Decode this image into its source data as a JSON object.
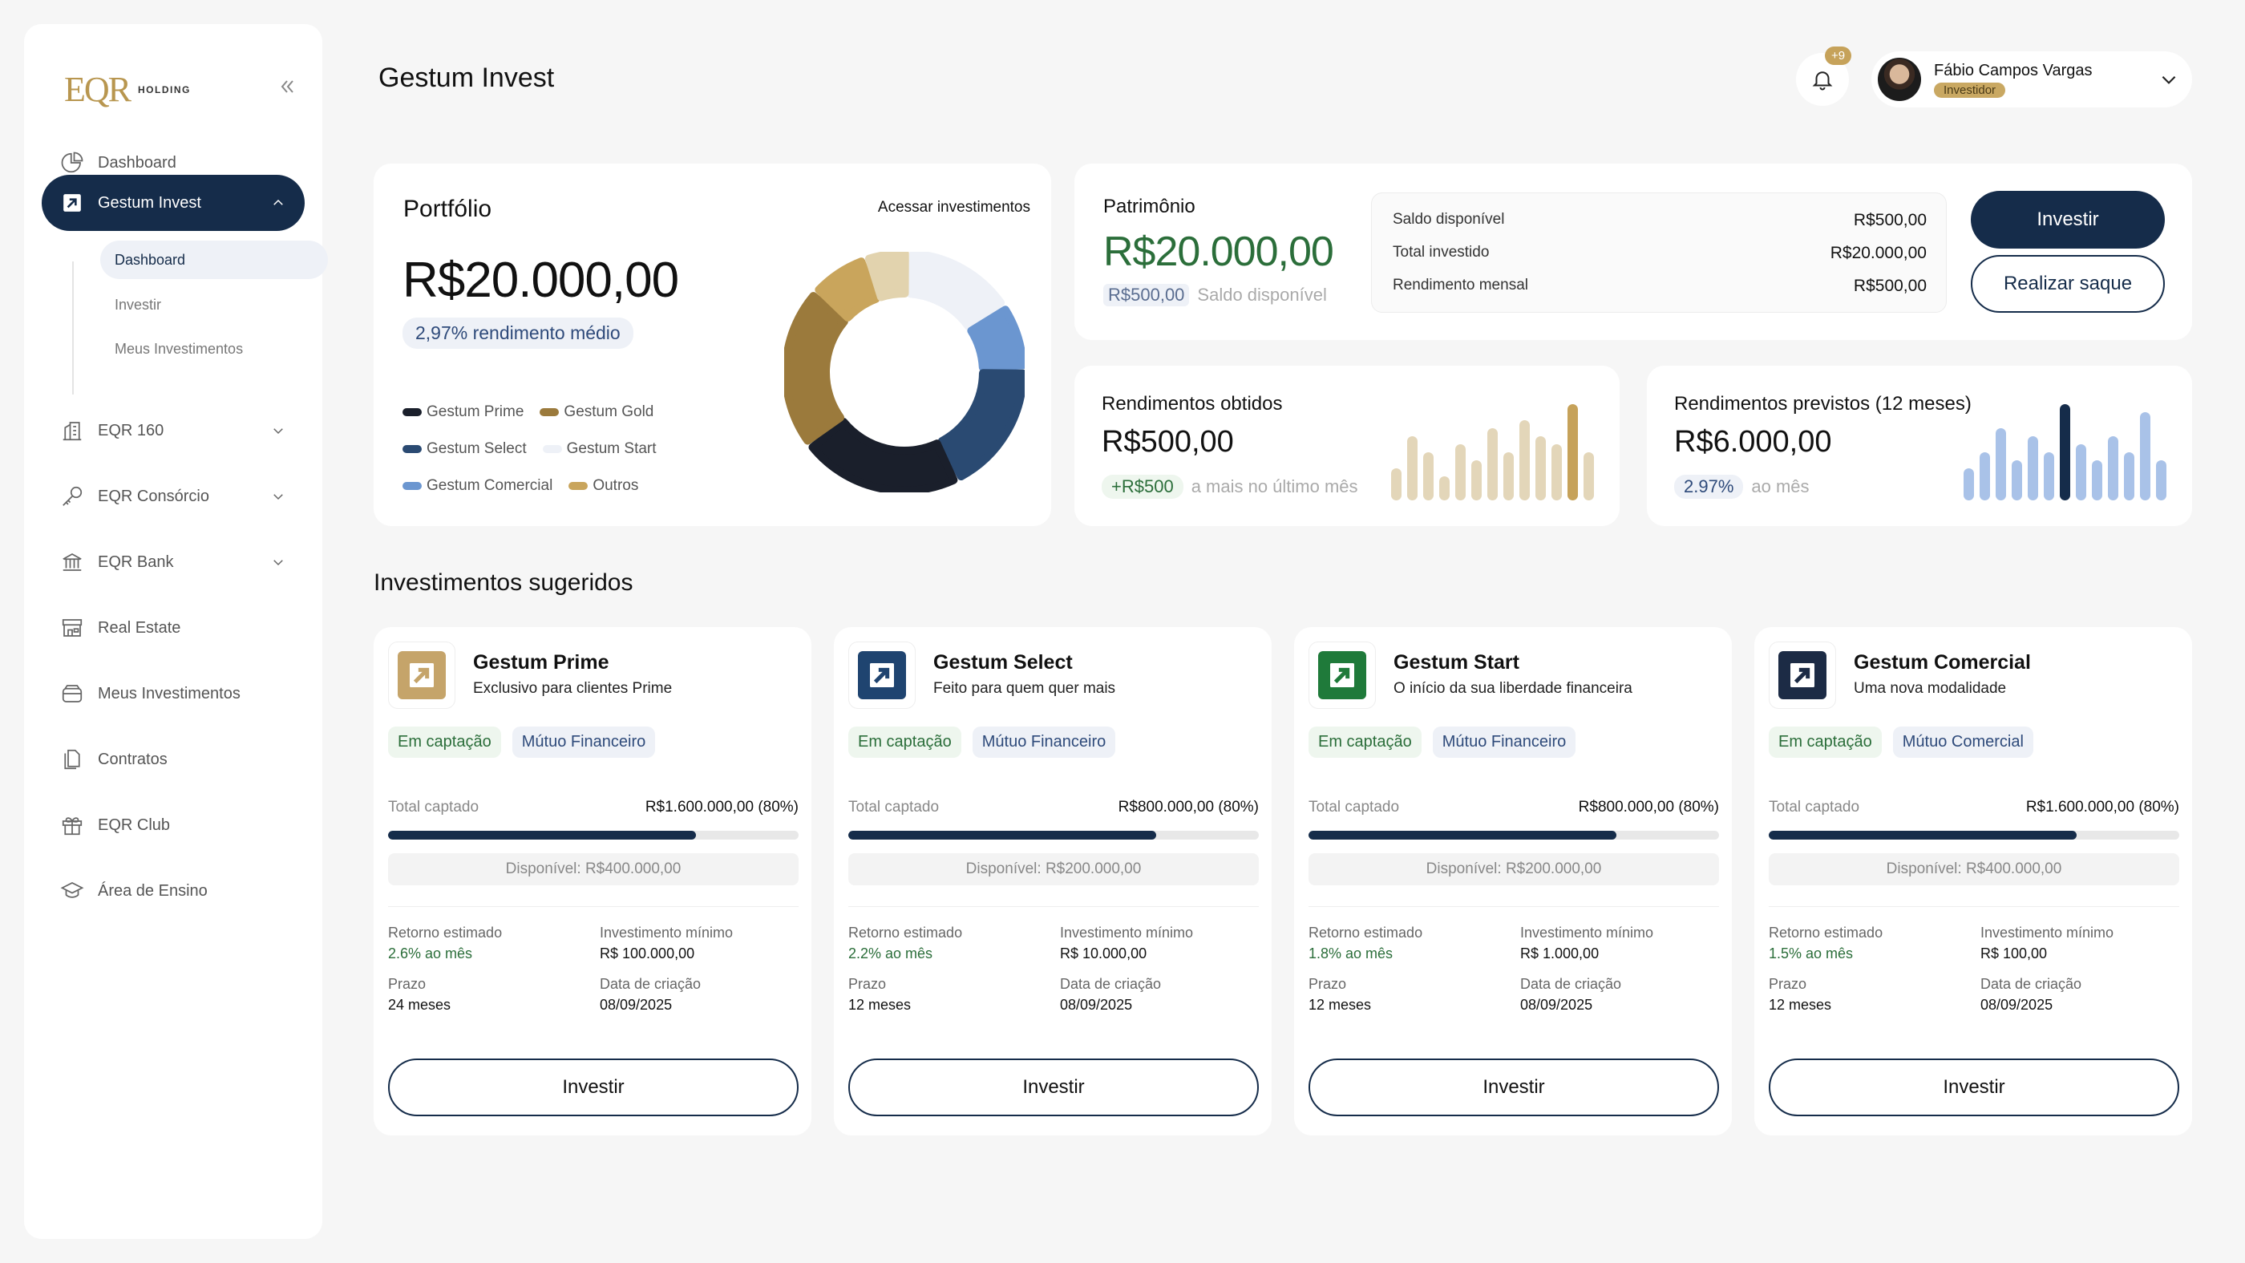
{
  "brand": {
    "logo_mark": "EQR",
    "logo_text": "HOLDING"
  },
  "sidebar": {
    "items": [
      {
        "label": "Dashboard",
        "icon": "pie-chart-icon"
      },
      {
        "label": "Gestum Invest",
        "icon": "arrow-up-right-icon",
        "active": true,
        "expanded": true
      },
      {
        "label": "EQR 160",
        "icon": "building-icon"
      },
      {
        "label": "EQR Consórcio",
        "icon": "key-icon"
      },
      {
        "label": "EQR Bank",
        "icon": "bank-icon"
      },
      {
        "label": "Real Estate",
        "icon": "storefront-icon"
      },
      {
        "label": "Meus Investimentos",
        "icon": "wallet-icon"
      },
      {
        "label": "Contratos",
        "icon": "documents-icon"
      },
      {
        "label": "EQR Club",
        "icon": "gift-icon"
      },
      {
        "label": "Área de Ensino",
        "icon": "graduation-cap-icon"
      }
    ],
    "subitems": [
      {
        "label": "Dashboard",
        "active": true
      },
      {
        "label": "Investir"
      },
      {
        "label": "Meus Investimentos"
      }
    ]
  },
  "header": {
    "title": "Gestum Invest",
    "notifications": "+9",
    "user_name": "Fábio Campos Vargas",
    "user_role": "Investidor"
  },
  "portfolio": {
    "title": "Portfólio",
    "link": "Acessar investimentos",
    "value": "R$20.000,00",
    "rendimento": "2,97% rendimento médio",
    "legend": [
      {
        "label": "Gestum Prime",
        "color": "#1a1f2b"
      },
      {
        "label": "Gestum Gold",
        "color": "#9b7a3c"
      },
      {
        "label": "Gestum Select",
        "color": "#2a4a72"
      },
      {
        "label": "Gestum Start",
        "color": "#eef1f7"
      },
      {
        "label": "Gestum Comercial",
        "color": "#6b96d0"
      },
      {
        "label": "Outros",
        "color": "#c9a55c"
      }
    ]
  },
  "chart_data": [
    {
      "type": "pie",
      "categories": [
        "Gestum Start",
        "Gestum Comercial",
        "Gestum Select",
        "Gestum Prime",
        "Gestum Gold",
        "Outros",
        "Outros"
      ],
      "values": [
        15,
        9,
        18,
        22,
        22,
        8,
        6
      ],
      "colors": [
        "#eef1f7",
        "#6b96d0",
        "#2a4a72",
        "#1a1f2b",
        "#9b7a3c",
        "#c9a55c",
        "#e2d3ae"
      ]
    },
    {
      "type": "bar",
      "values": [
        4,
        8,
        6,
        3,
        7,
        5,
        9,
        6,
        10,
        8,
        7,
        12,
        6
      ],
      "colors": [
        "#e3d6b9",
        "#e3d6b9",
        "#e3d6b9",
        "#e3d6b9",
        "#e3d6b9",
        "#e3d6b9",
        "#e3d6b9",
        "#e3d6b9",
        "#e3d6b9",
        "#e3d6b9",
        "#e3d6b9",
        "#c6a25a",
        "#e3d6b9"
      ]
    },
    {
      "type": "bar",
      "values": [
        4,
        6,
        9,
        5,
        8,
        6,
        12,
        7,
        5,
        8,
        6,
        11,
        5
      ],
      "colors": [
        "#a9c2e8",
        "#a9c2e8",
        "#a9c2e8",
        "#a9c2e8",
        "#a9c2e8",
        "#a9c2e8",
        "#152c4a",
        "#a9c2e8",
        "#a9c2e8",
        "#a9c2e8",
        "#a9c2e8",
        "#a9c2e8",
        "#a9c2e8"
      ]
    }
  ],
  "patrimonio": {
    "title": "Patrimônio",
    "value": "R$20.000,00",
    "sub_chip": "R$500,00",
    "sub_text": "Saldo disponível",
    "rows": [
      {
        "label": "Saldo disponível",
        "value": "R$500,00"
      },
      {
        "label": "Total investido",
        "value": "R$20.000,00"
      },
      {
        "label": "Rendimento mensal",
        "value": "R$500,00"
      }
    ],
    "invest_label": "Investir",
    "saque_label": "Realizar saque"
  },
  "rendimentos_obtidos": {
    "title": "Rendimentos obtidos",
    "value": "R$500,00",
    "chip": "+R$500",
    "sub": "a mais no último mês"
  },
  "rendimentos_previstos": {
    "title": "Rendimentos previstos (12 meses)",
    "value": "R$6.000,00",
    "chip": "2.97%",
    "sub": "ao mês"
  },
  "suggested": {
    "title": "Investimentos sugeridos",
    "labels": {
      "total": "Total captado",
      "retorno": "Retorno estimado",
      "minimo": "Investimento mínimo",
      "prazo": "Prazo",
      "criacao": "Data de criação",
      "button": "Investir"
    },
    "cards": [
      {
        "name": "Gestum Prime",
        "desc": "Exclusivo para clientes Prime",
        "logo_bg": "#c5a46a",
        "tag1": "Em captação",
        "tag2": "Mútuo Financeiro",
        "total": "R$1.600.000,00 (80%)",
        "progress": 0.75,
        "disp": "Disponível: R$400.000,00",
        "retorno": "2.6% ao mês",
        "minimo": "R$ 100.000,00",
        "prazo": "24 meses",
        "criacao": "08/09/2025"
      },
      {
        "name": "Gestum Select",
        "desc": "Feito para quem quer mais",
        "logo_bg": "#1f4470",
        "tag1": "Em captação",
        "tag2": "Mútuo Financeiro",
        "total": "R$800.000,00 (80%)",
        "progress": 0.75,
        "disp": "Disponível: R$200.000,00",
        "retorno": "2.2% ao mês",
        "minimo": "R$ 10.000,00",
        "prazo": "12 meses",
        "criacao": "08/09/2025"
      },
      {
        "name": "Gestum Start",
        "desc": "O início da sua liberdade financeira",
        "logo_bg": "#1f7a3a",
        "tag1": "Em captação",
        "tag2": "Mútuo Financeiro",
        "total": "R$800.000,00 (80%)",
        "progress": 0.75,
        "disp": "Disponível: R$200.000,00",
        "retorno": "1.8% ao mês",
        "minimo": "R$ 1.000,00",
        "prazo": "12 meses",
        "criacao": "08/09/2025"
      },
      {
        "name": "Gestum Comercial",
        "desc": "Uma nova modalidade",
        "logo_bg": "#1c2b45",
        "tag1": "Em captação",
        "tag2": "Mútuo Comercial",
        "total": "R$1.600.000,00 (80%)",
        "progress": 0.75,
        "disp": "Disponível: R$400.000,00",
        "retorno": "1.5% ao mês",
        "minimo": "R$ 100,00",
        "prazo": "12 meses",
        "criacao": "08/09/2025"
      }
    ]
  }
}
